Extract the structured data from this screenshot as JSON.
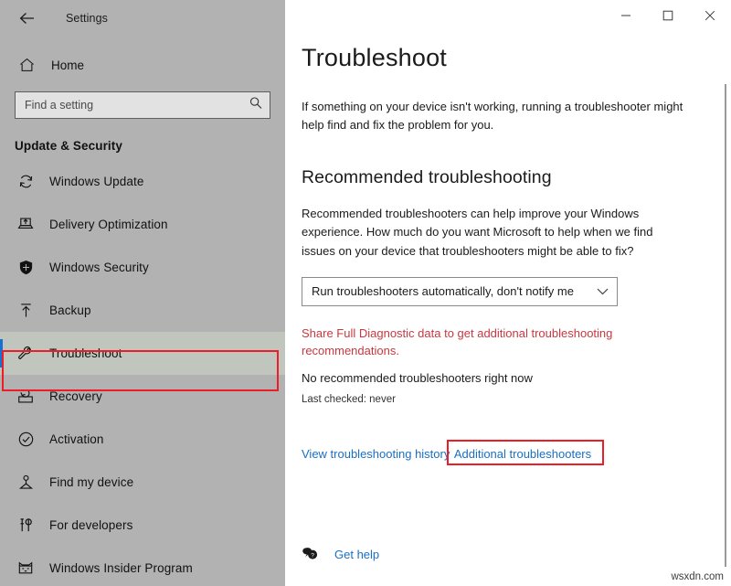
{
  "titlebar": {
    "app_title": "Settings",
    "back_label": "Back",
    "minimize_label": "Minimize",
    "maximize_label": "Maximize",
    "close_label": "Close"
  },
  "sidebar": {
    "home_label": "Home",
    "search": {
      "placeholder": "Find a setting",
      "value": ""
    },
    "section_title": "Update & Security",
    "items": [
      {
        "label": "Windows Update",
        "icon": "refresh-icon",
        "selected": false
      },
      {
        "label": "Delivery Optimization",
        "icon": "delivery-icon",
        "selected": false
      },
      {
        "label": "Windows Security",
        "icon": "shield-icon",
        "selected": false
      },
      {
        "label": "Backup",
        "icon": "upload-icon",
        "selected": false
      },
      {
        "label": "Troubleshoot",
        "icon": "wrench-icon",
        "selected": true
      },
      {
        "label": "Recovery",
        "icon": "recovery-icon",
        "selected": false
      },
      {
        "label": "Activation",
        "icon": "check-circle-icon",
        "selected": false
      },
      {
        "label": "Find my device",
        "icon": "find-device-icon",
        "selected": false
      },
      {
        "label": "For developers",
        "icon": "developer-tools-icon",
        "selected": false
      },
      {
        "label": "Windows Insider Program",
        "icon": "ninjacat-icon",
        "selected": false
      }
    ]
  },
  "main": {
    "page_title": "Troubleshoot",
    "intro": "If something on your device isn't working, running a troubleshooter might help find and fix the problem for you.",
    "recommended": {
      "heading": "Recommended troubleshooting",
      "body": "Recommended troubleshooters can help improve your Windows experience. How much do you want Microsoft to help when we find issues on your device that troubleshooters might be able to fix?",
      "dropdown_value": "Run troubleshooters automatically, don't notify me",
      "warning": "Share Full Diagnostic data to get additional troubleshooting recommendations.",
      "status": "No recommended troubleshooters right now",
      "last_checked": "Last checked: never"
    },
    "links": {
      "history": "View troubleshooting history",
      "additional": "Additional troubleshooters",
      "get_help": "Get help"
    }
  },
  "colors": {
    "accent_blue": "#1372d4",
    "link_blue": "#1a6fc4",
    "warning_red": "#c8383f",
    "annotation_red": "#ee1c25",
    "sidebar_bg": "#b2b2b2",
    "selected_bg": "#c0c6bd"
  },
  "watermark": "wsxdn.com"
}
